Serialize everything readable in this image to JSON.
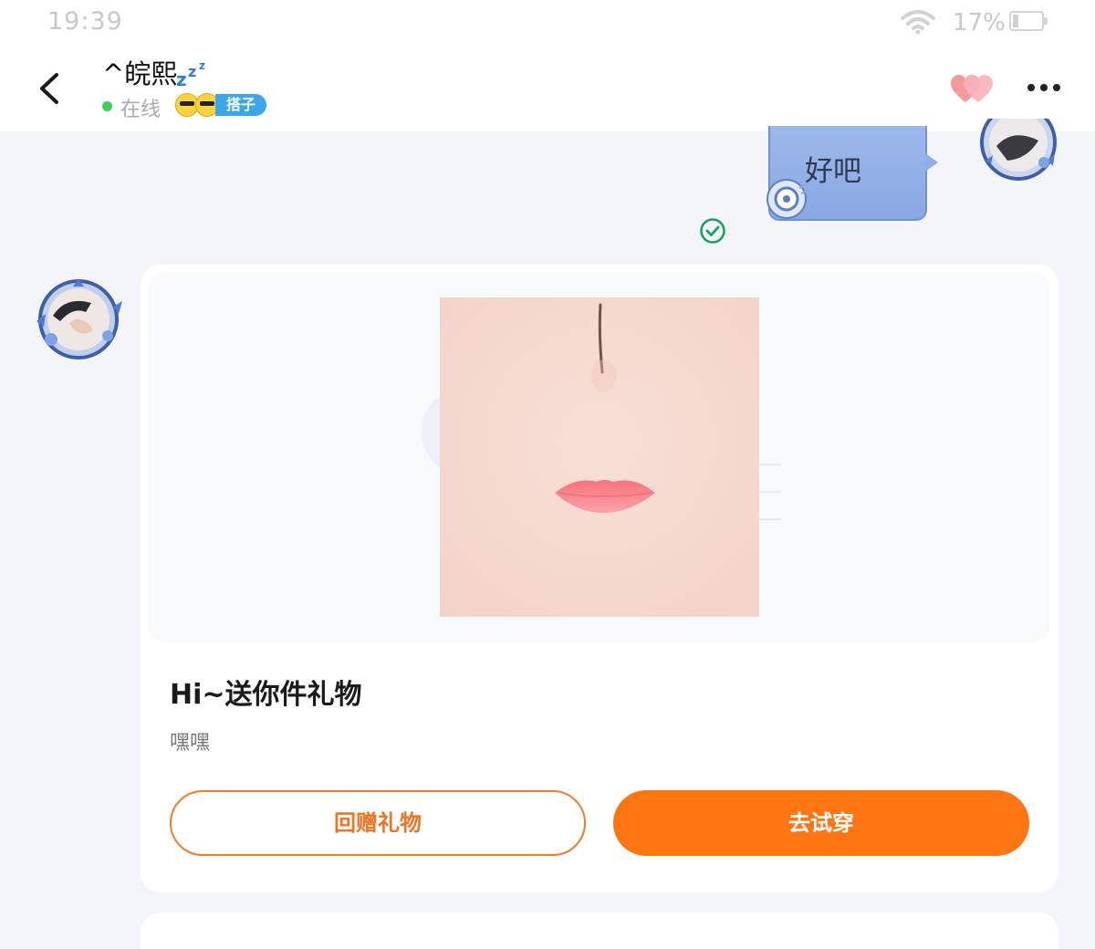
{
  "status_bar": {
    "time": "19:39",
    "battery": "17%",
    "icons": [
      "wifi-icon",
      "battery-icon"
    ]
  },
  "header": {
    "contact_name": "^皖熙",
    "name_icon": "sleep-zzz-icon",
    "status": "在线",
    "status_color": "#3ccf5c",
    "badge_label": "搭子",
    "badge_color": "#3aa8e8",
    "icons": [
      "back-arrow-icon",
      "heart-icon",
      "more-icon"
    ]
  },
  "messages": {
    "sent_text": "好吧",
    "read_icon": "check-circle-icon",
    "bubble_color": "#9db8ea"
  },
  "gift_card": {
    "title": "Hi~送你件礼物",
    "message": "嘿嘿",
    "return_button": "回赠礼物",
    "try_on_button": "去试穿",
    "accent_color": "#ff7512"
  }
}
